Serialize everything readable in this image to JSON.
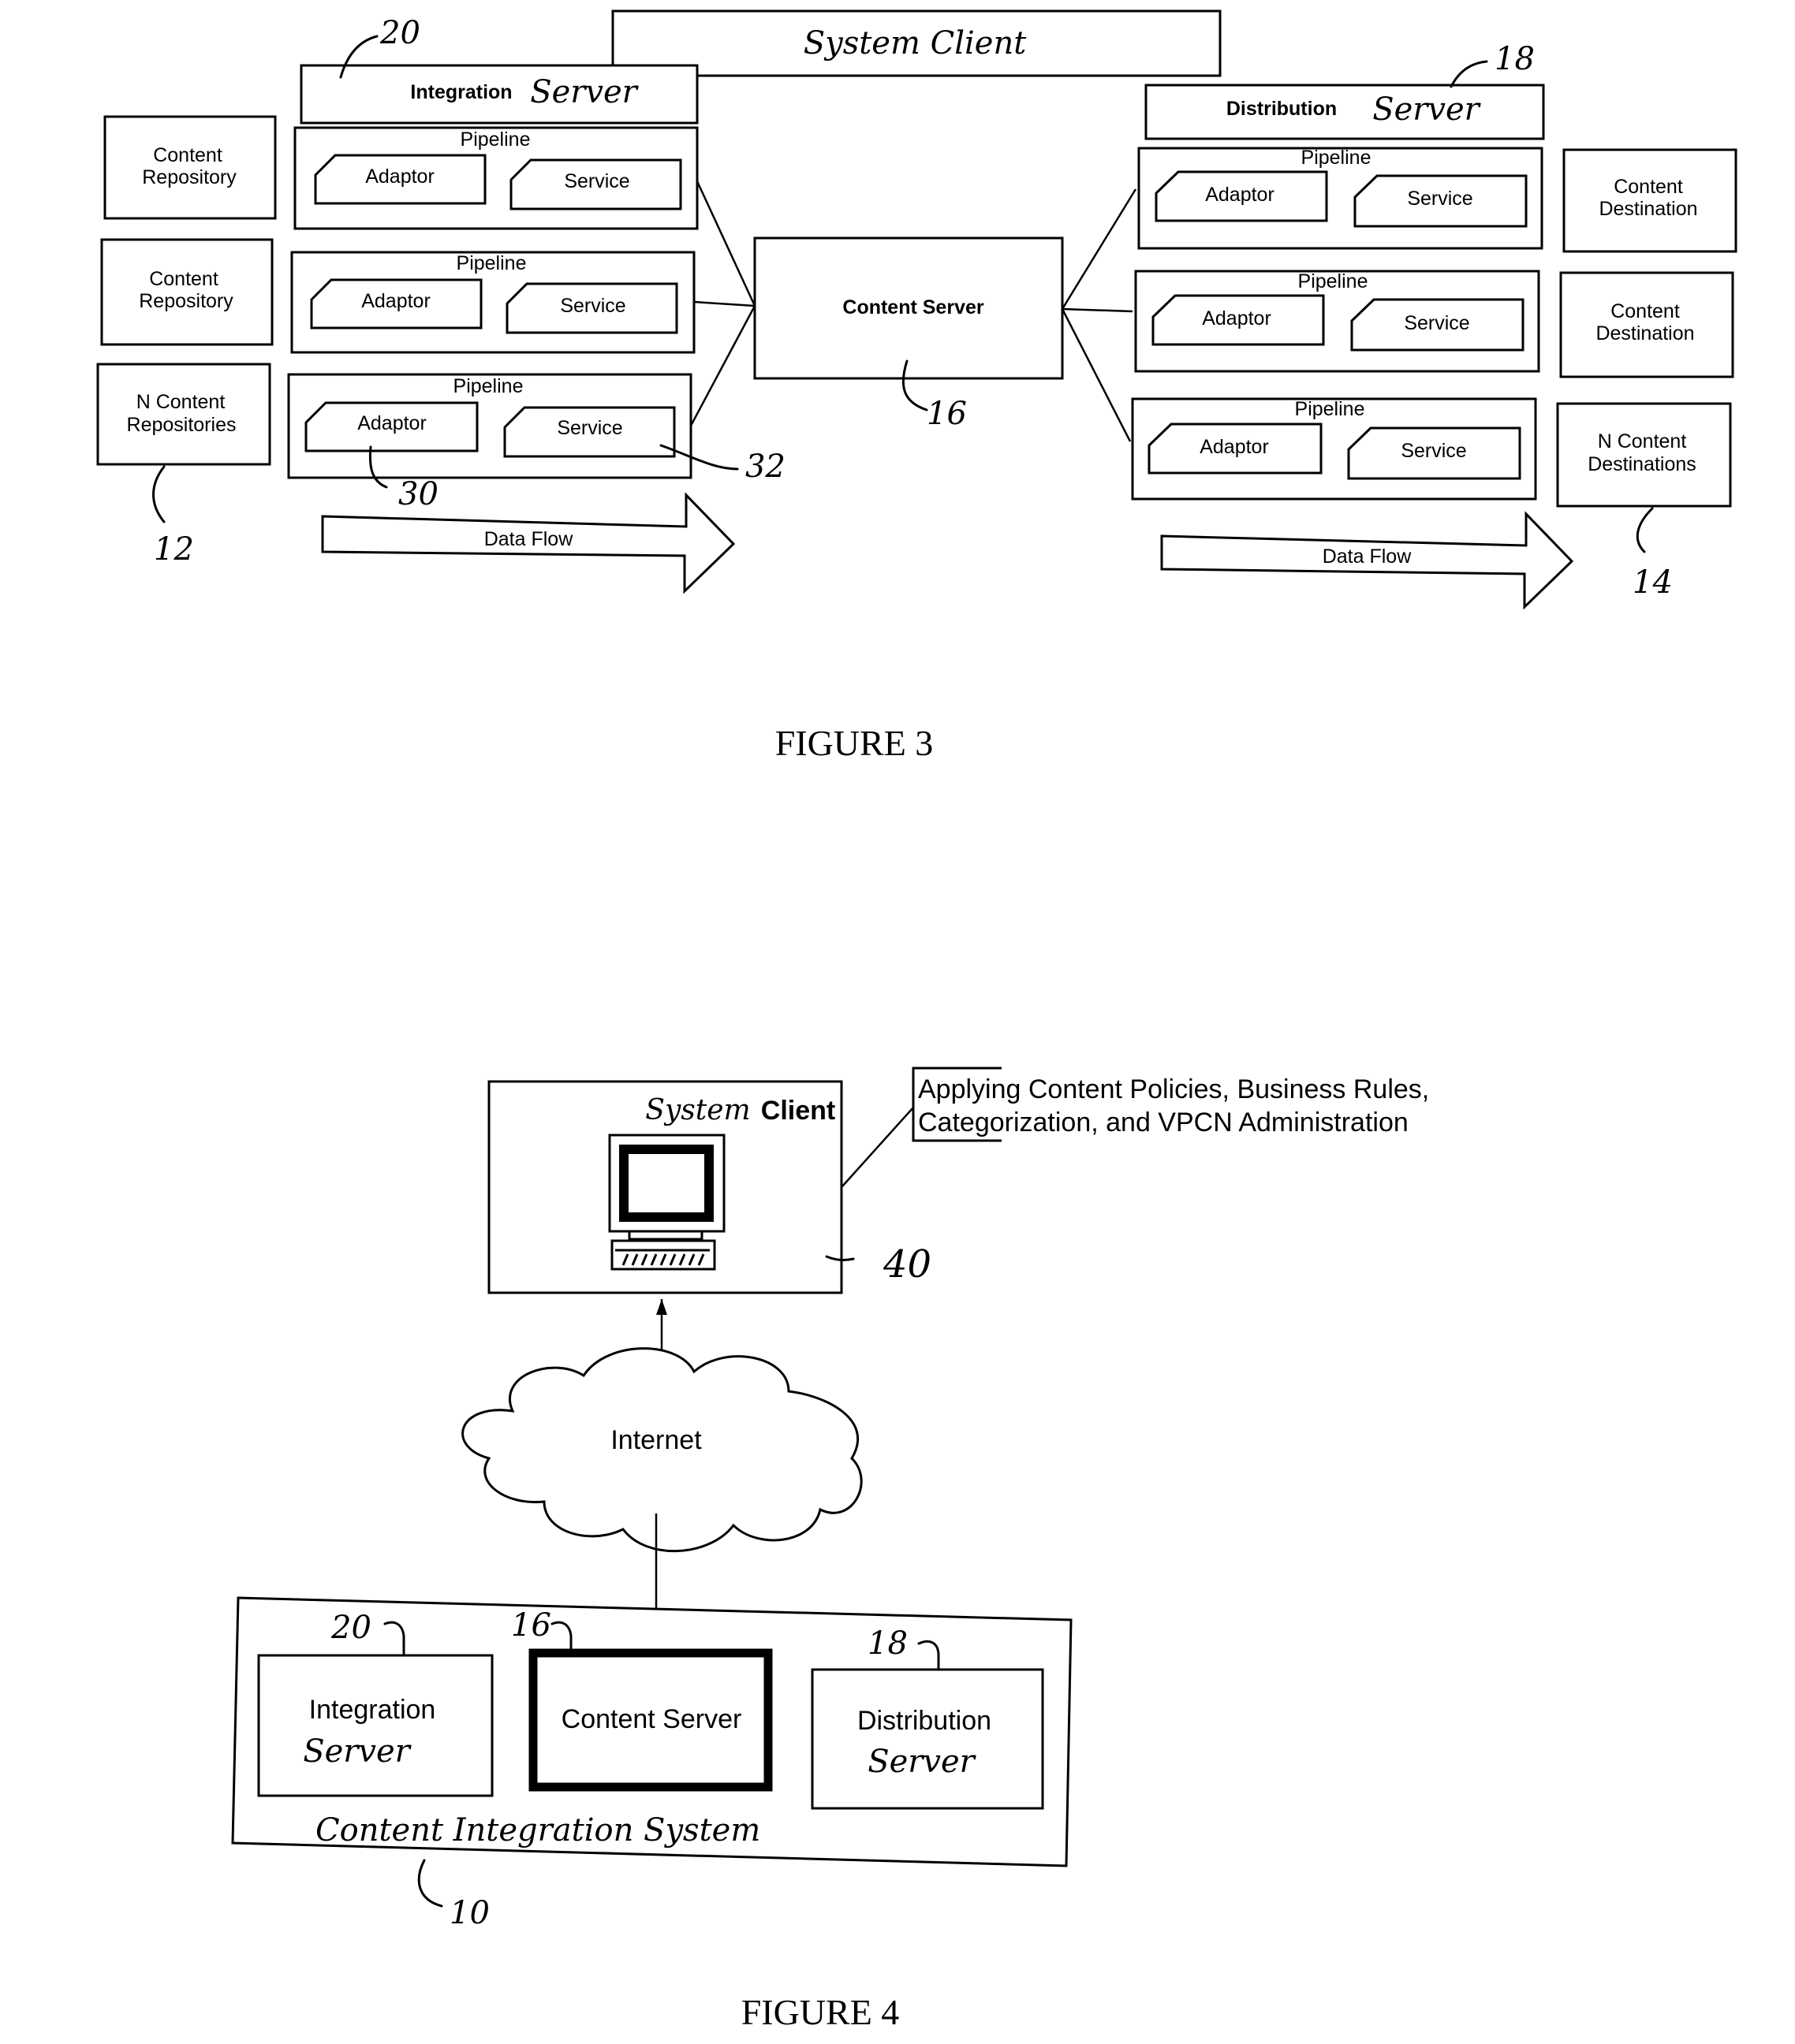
{
  "figure3": {
    "caption": "FIGURE 3",
    "system_client": "System Client",
    "integration_server": {
      "label_printed": "Integration",
      "label_handwritten": "Server",
      "ref": "20",
      "pipelines": [
        {
          "title": "Pipeline",
          "adaptor": "Adaptor",
          "service": "Service"
        },
        {
          "title": "Pipeline",
          "adaptor": "Adaptor",
          "service": "Service"
        },
        {
          "title": "Pipeline",
          "adaptor": "Adaptor",
          "service": "Service"
        }
      ]
    },
    "repositories": {
      "items": [
        {
          "line1": "Content",
          "line2": "Repository"
        },
        {
          "line1": "Content",
          "line2": "Repository"
        },
        {
          "line1": "N Content",
          "line2": "Repositories"
        }
      ],
      "ref": "12"
    },
    "content_server": {
      "label": "Content Server",
      "ref": "16"
    },
    "distribution_server": {
      "label_printed": "Distribution",
      "label_handwritten": "Server",
      "ref": "18",
      "pipelines": [
        {
          "title": "Pipeline",
          "adaptor": "Adaptor",
          "service": "Service"
        },
        {
          "title": "Pipeline",
          "adaptor": "Adaptor",
          "service": "Service"
        },
        {
          "title": "Pipeline",
          "adaptor": "Adaptor",
          "service": "Service"
        }
      ]
    },
    "destinations": {
      "items": [
        {
          "line1": "Content",
          "line2": "Destination"
        },
        {
          "line1": "Content",
          "line2": "Destination"
        },
        {
          "line1": "N Content",
          "line2": "Destinations"
        }
      ],
      "ref": "14"
    },
    "adaptor_ref": "30",
    "service_ref": "32",
    "data_flow_left": "Data Flow",
    "data_flow_right": "Data Flow"
  },
  "figure4": {
    "caption": "FIGURE 4",
    "system_client": {
      "label_handwritten": "System",
      "label_printed": "Client",
      "ref": "40"
    },
    "callout": {
      "line1": "Applying Content Policies, Business Rules,",
      "line2": "Categorization, and VPCN Administration"
    },
    "internet": "Internet",
    "integration_system": {
      "label": "Content Integration System",
      "ref": "10",
      "integration_server": {
        "line1": "Integration",
        "line2": "Server",
        "ref": "20"
      },
      "content_server": {
        "label": "Content Server",
        "ref": "16"
      },
      "distribution_server": {
        "line1": "Distribution",
        "line2": "Server",
        "ref": "18"
      }
    }
  }
}
